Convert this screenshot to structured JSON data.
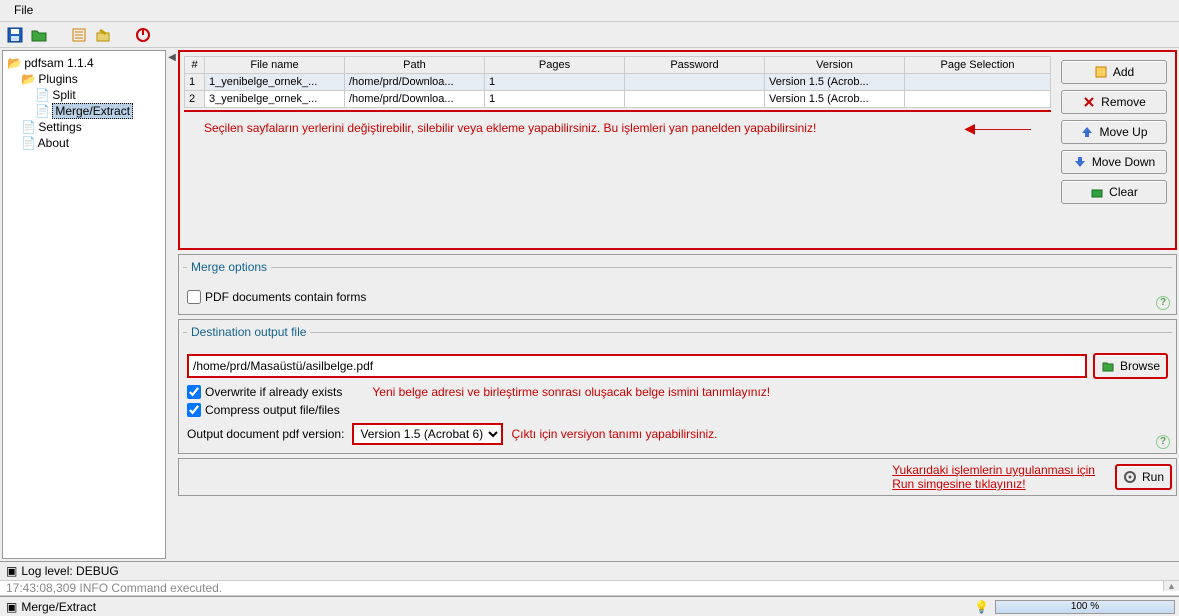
{
  "menu": {
    "file": "File"
  },
  "tree": {
    "root": "pdfsam 1.1.4",
    "plugins": "Plugins",
    "split": "Split",
    "merge": "Merge/Extract",
    "settings": "Settings",
    "about": "About"
  },
  "table": {
    "headers": {
      "num": "#",
      "filename": "File name",
      "path": "Path",
      "pages": "Pages",
      "password": "Password",
      "version": "Version",
      "pagesel": "Page Selection"
    },
    "rows": [
      {
        "num": "1",
        "filename": "1_yenibelge_ornek_...",
        "path": "/home/prd/Downloa...",
        "pages": "1",
        "password": "",
        "version": "Version 1.5 (Acrob...",
        "pagesel": ""
      },
      {
        "num": "2",
        "filename": "3_yenibelge_ornek_...",
        "path": "/home/prd/Downloa...",
        "pages": "1",
        "password": "",
        "version": "Version 1.5 (Acrob...",
        "pagesel": ""
      }
    ]
  },
  "buttons": {
    "add": "Add",
    "remove": "Remove",
    "moveup": "Move Up",
    "movedown": "Move Down",
    "clear": "Clear",
    "browse": "Browse",
    "run": "Run"
  },
  "annot": {
    "files": "Seçilen sayfaların yerlerini değiştirebilir, silebilir veya ekleme yapabilirsiniz. Bu işlemleri yan panelden yapabilirsiniz!",
    "dest": "Yeni belge adresi ve birleştirme sonrası oluşacak belge ismini tanımlayınız!",
    "version": "Çıktı için versiyon tanımı yapabilirsiniz.",
    "run": "Yukarıdaki işlemlerin uygulanması için\nRun simgesine tıklayınız!"
  },
  "merge": {
    "title": "Merge options",
    "forms": "PDF documents contain forms"
  },
  "dest": {
    "title": "Destination output file",
    "path": "/home/prd/Masaüstü/asilbelge.pdf",
    "overwrite": "Overwrite if already exists",
    "compress": "Compress output file/files",
    "verlabel": "Output document pdf version:",
    "verval": "Version 1.5 (Acrobat 6)"
  },
  "log": {
    "level": "Log level: DEBUG",
    "line": "17:43:08,309 INFO  Command executed."
  },
  "status": {
    "tab": "Merge/Extract",
    "progress": "100 %"
  }
}
